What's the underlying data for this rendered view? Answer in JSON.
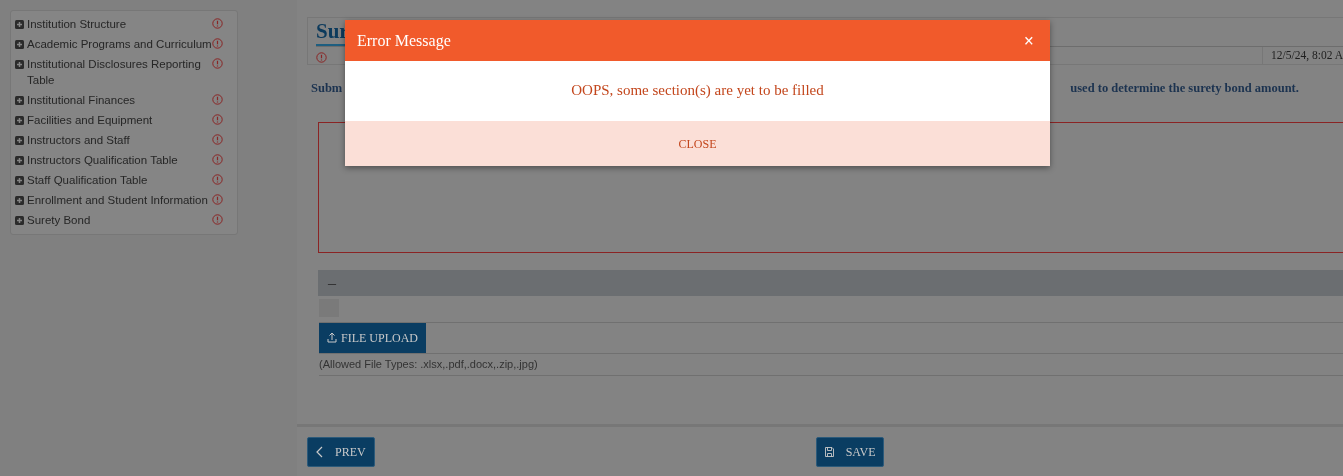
{
  "sidebar": {
    "items": [
      {
        "label": "Institution Structure"
      },
      {
        "label": "Academic Programs and Curriculum"
      },
      {
        "label": "Institutional Disclosures Reporting Table"
      },
      {
        "label": "Institutional Finances"
      },
      {
        "label": "Facilities and Equipment"
      },
      {
        "label": "Instructors and Staff"
      },
      {
        "label": "Instructors Qualification Table"
      },
      {
        "label": "Staff Qualification Table"
      },
      {
        "label": "Enrollment and Student Information"
      },
      {
        "label": "Surety Bond"
      }
    ]
  },
  "section": {
    "title": "Sur",
    "timestamp": "12/5/24, 8:02 A",
    "instruction_start": "Subm",
    "instruction_end": "used to determine the surety bond amount.",
    "collapse_label": "–",
    "upload_button": "FILE UPLOAD",
    "allowed_types": "(Allowed File Types: .xlsx,.pdf,.docx,.zip,.jpg)"
  },
  "footer": {
    "prev_button": "PREV",
    "save_button": "SAVE"
  },
  "modal": {
    "title": "Error Message",
    "close_glyph": "×",
    "message": "OOPS, some section(s) are yet to be filled",
    "close_button": "CLOSE"
  }
}
